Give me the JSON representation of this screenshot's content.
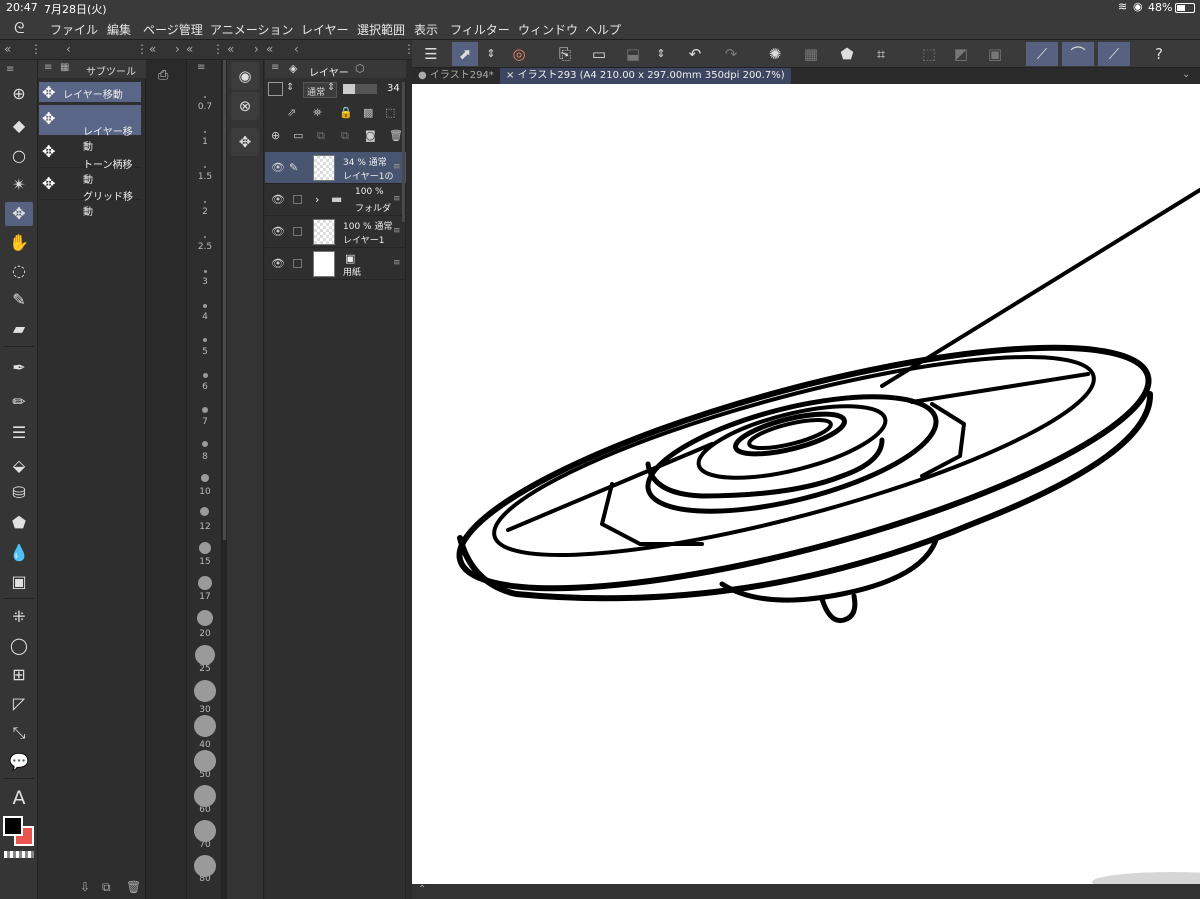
{
  "status": {
    "time": "20:47",
    "date": "7月28日(火)",
    "battery": "48%"
  },
  "menu": [
    "ファイル",
    "編集",
    "ページ管理",
    "アニメーション",
    "レイヤー",
    "選択範囲",
    "表示",
    "フィルター",
    "ウィンドウ",
    "ヘルプ"
  ],
  "subtool": {
    "tab_label": "サブツール",
    "group_label": "レイヤー移動",
    "items": [
      "レイヤー移動",
      "トーン柄移動",
      "グリッド移動"
    ]
  },
  "brush_sizes": [
    "0.7",
    "1",
    "1.5",
    "2",
    "2.5",
    "3",
    "4",
    "5",
    "6",
    "7",
    "8",
    "10",
    "12",
    "15",
    "17",
    "20",
    "25",
    "30",
    "40",
    "50",
    "60",
    "70",
    "80"
  ],
  "layers": {
    "tab_label": "レイヤー",
    "blend_mode": "通常",
    "opacity_value": "34",
    "rows": [
      {
        "top": "34 % 通常",
        "name": "レイヤー1の"
      },
      {
        "top": "100 %",
        "name": "フォルダ"
      },
      {
        "top": "100 % 通常",
        "name": "レイヤー1"
      },
      {
        "top": "",
        "name": "用紙"
      }
    ]
  },
  "document_tabs": [
    {
      "label": "イラスト294*"
    },
    {
      "label": "イラスト293 (A4 210.00 x 297.00mm 350dpi 200.7%)"
    }
  ],
  "colors": {
    "main": "#000000",
    "sub": "#e8554e",
    "accent": "#56627f"
  }
}
